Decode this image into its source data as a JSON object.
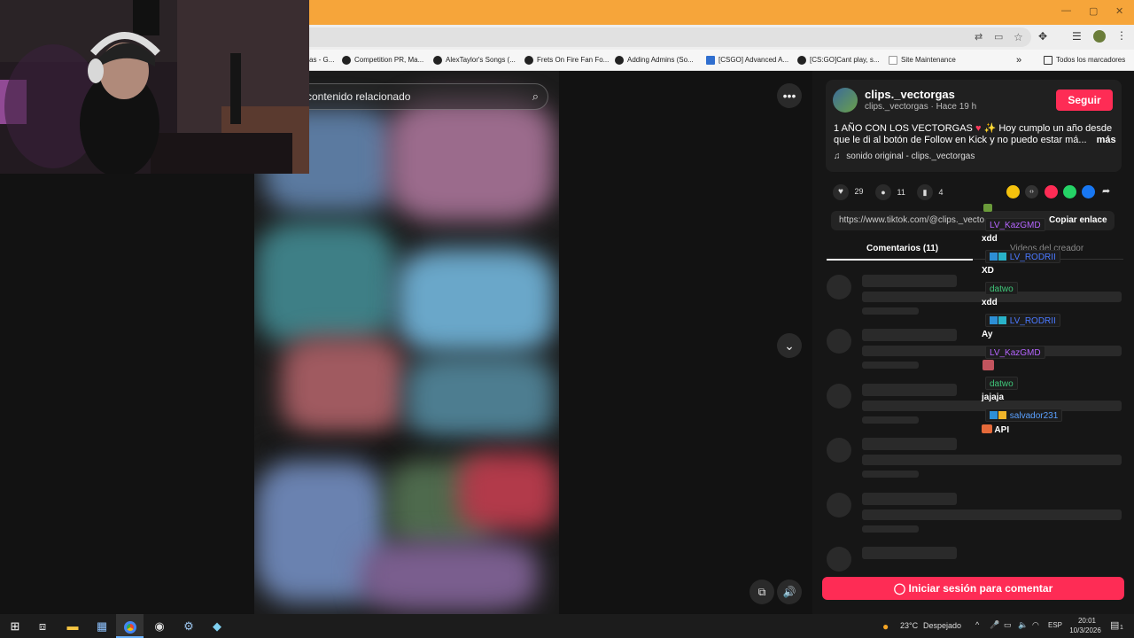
{
  "browser": {
    "url_fragment": "3",
    "window_controls": [
      "—",
      "▢",
      "✕"
    ],
    "bookmarks": [
      {
        "label": "as - G..."
      },
      {
        "label": "Competition PR, Ma..."
      },
      {
        "label": "AlexTaylor's Songs (..."
      },
      {
        "label": "Frets On Fire Fan Fo..."
      },
      {
        "label": "Adding Admins (So..."
      },
      {
        "label": "[CSGO] Advanced A..."
      },
      {
        "label": "[CS:GO]Cant play, s..."
      },
      {
        "label": "Site Maintenance"
      }
    ],
    "bookmarks_overflow": "»",
    "all_bookmarks": "Todos los marcadores"
  },
  "video": {
    "search_placeholder": "contenido relacionado"
  },
  "post": {
    "username": "clips._vectorgas",
    "subline": "clips._vectorgas · Hace 19 h",
    "follow_label": "Seguir",
    "caption_line1": "1 AÑO CON LOS VECTORGAS",
    "caption_line1_rest": "Hoy cumplo un año desde",
    "caption_line2": "que le di al botón de Follow en Kick y no puedo estar má...",
    "more": "más",
    "sound": "sonido original - clips._vectorgas",
    "likes": "29",
    "comments": "11",
    "saves": "4",
    "link": "https://www.tiktok.com/@clips._vecto",
    "copy_link": "Copiar enlace",
    "tab_comments": "Comentarios (11)",
    "tab_creator": "Videos del creador",
    "login_button": "Iniciar sesión para comentar"
  },
  "chat": [
    {
      "user": "LV_KazGMD",
      "color": "#b565ff",
      "msg": "xdd"
    },
    {
      "user": "LV_RODRII",
      "color": "#4a78ff",
      "msg": "XD"
    },
    {
      "user": "datwo",
      "color": "#3fc87a",
      "msg": "xdd"
    },
    {
      "user": "LV_RODRII",
      "color": "#4a78ff",
      "msg": "Ay"
    },
    {
      "user": "LV_KazGMD",
      "color": "#b565ff",
      "msg": ""
    },
    {
      "user": "datwo",
      "color": "#3fc87a",
      "msg": "jajaja"
    },
    {
      "user": "salvador231",
      "color": "#5aa0ff",
      "msg": "API"
    }
  ],
  "taskbar": {
    "weather_temp": "23°C",
    "weather_desc": "Despejado",
    "lang": "ESP",
    "time": "20:01",
    "date": "10/3/2026",
    "notif_count": "1"
  },
  "colors": {
    "accent": "#fe2c55",
    "browser_frame": "#f6a53a"
  }
}
